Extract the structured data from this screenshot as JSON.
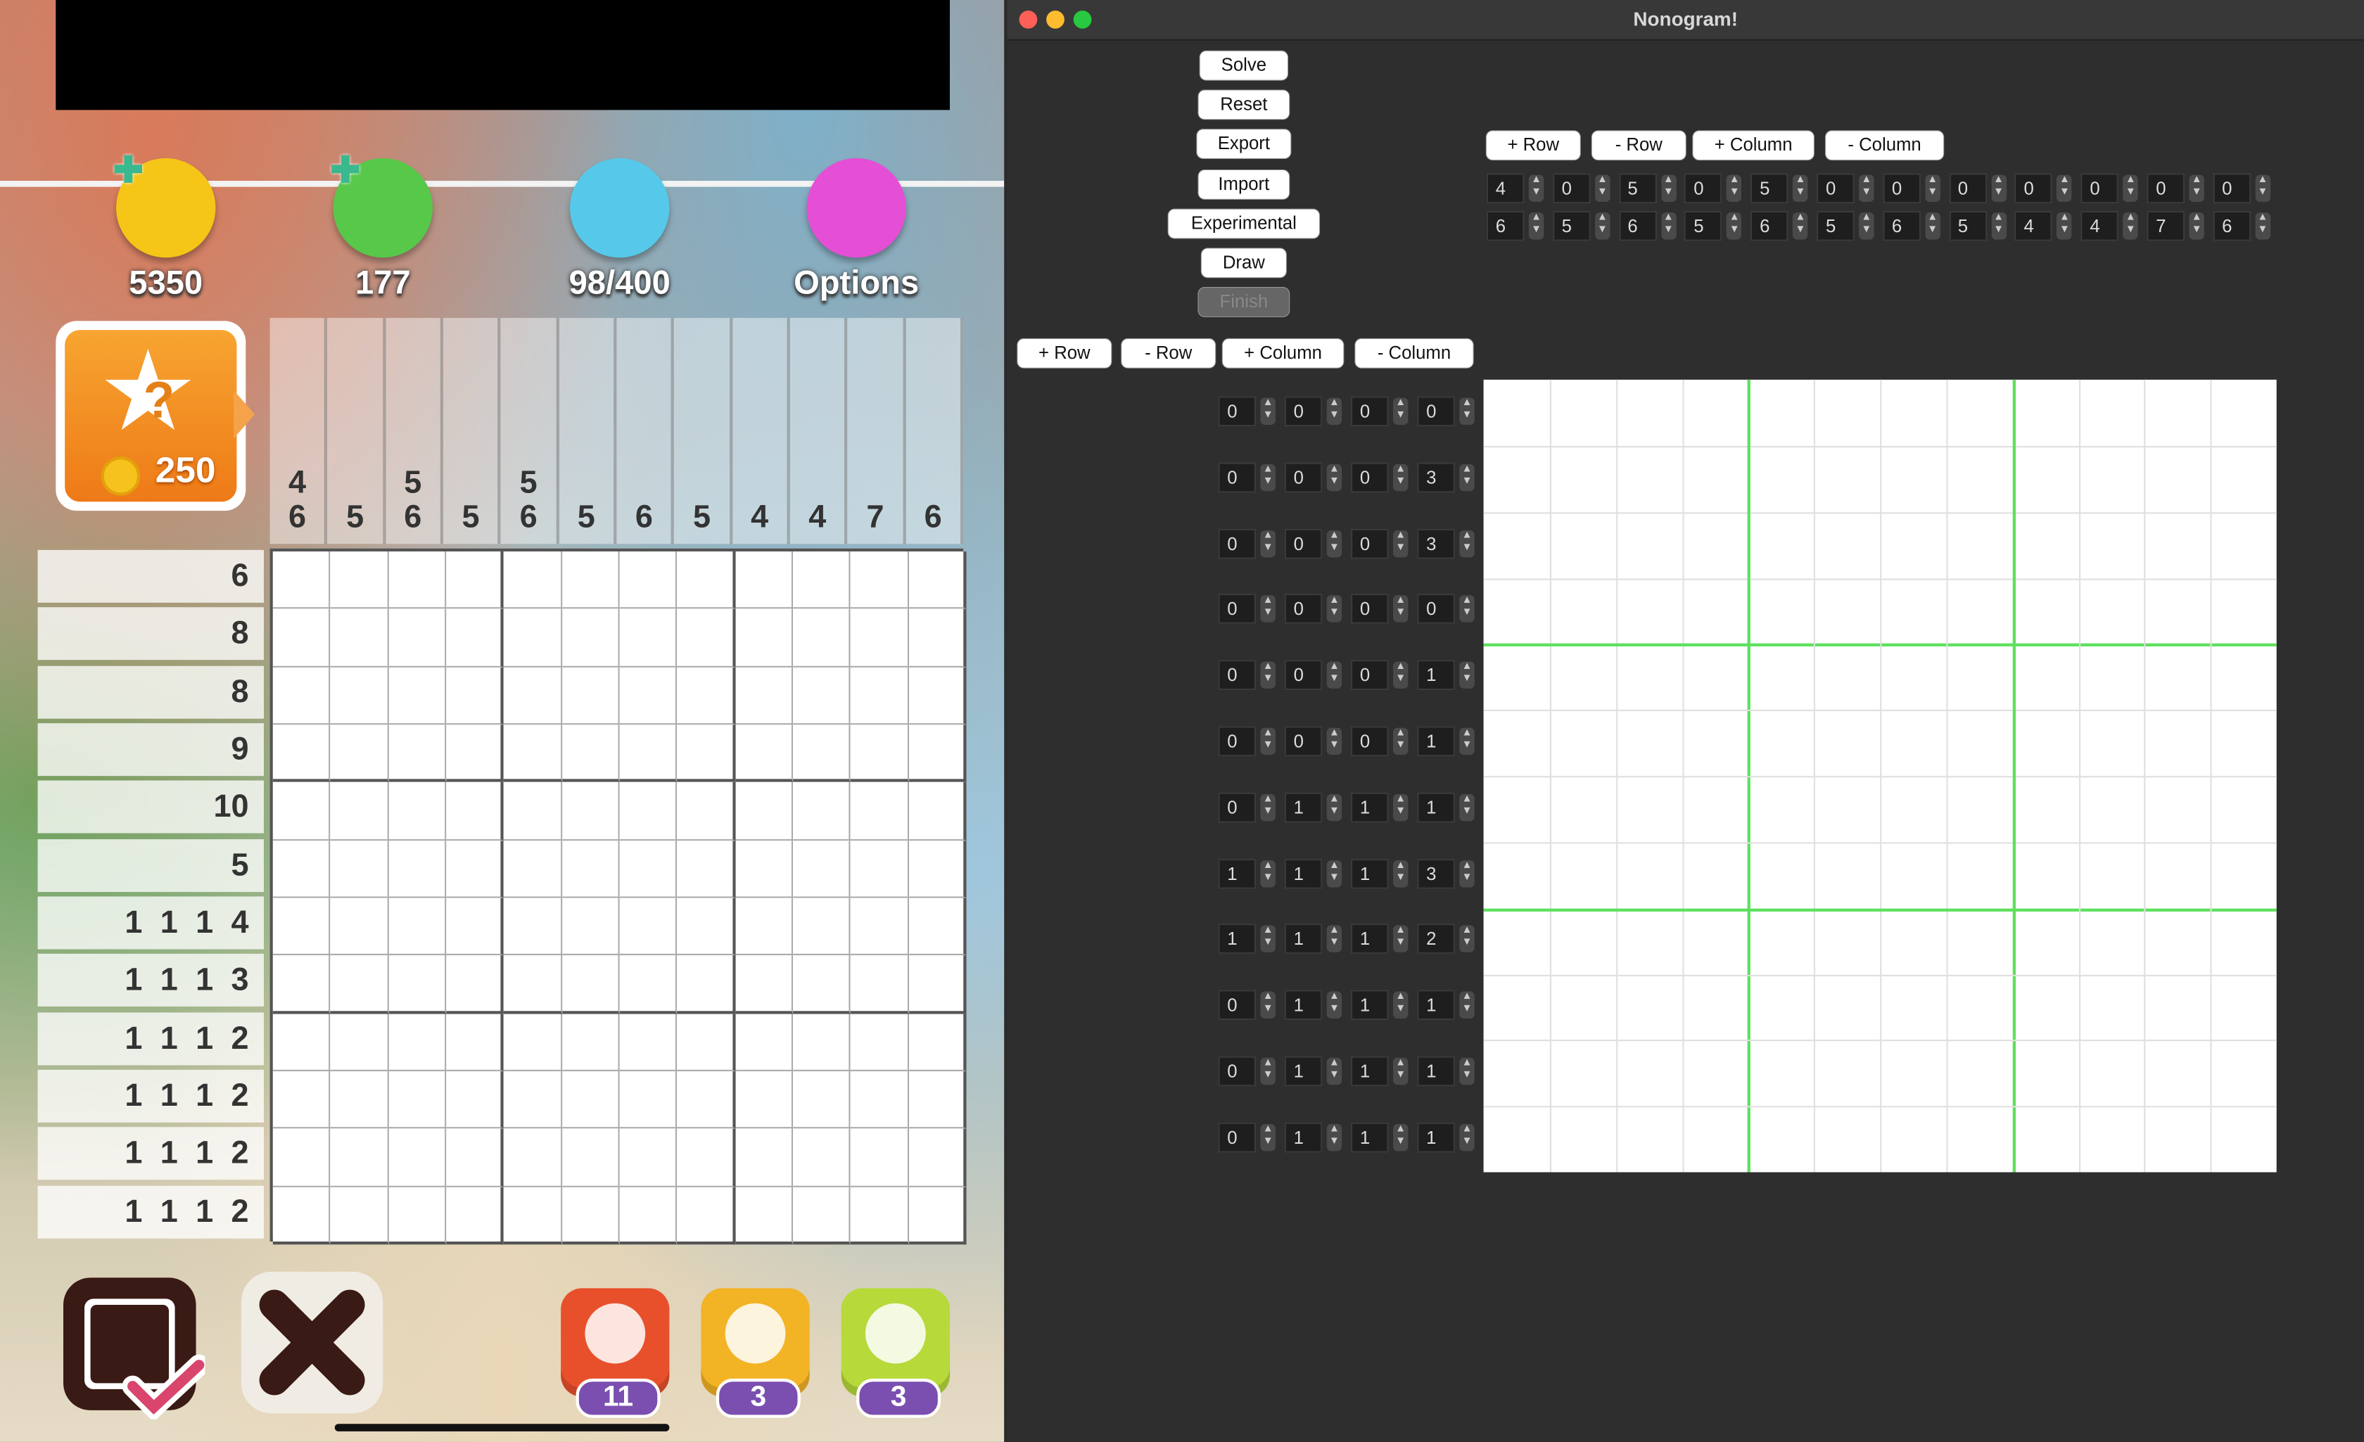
{
  "game": {
    "hud": [
      {
        "label": "5350",
        "icon": "gold-coin-icon",
        "color": "#f5c518"
      },
      {
        "label": "177",
        "icon": "green-question-coin-icon",
        "color": "#58c84a"
      },
      {
        "label": "98/400",
        "icon": "progress-chart-icon",
        "color": "#56c9ea"
      },
      {
        "label": "Options",
        "icon": "gear-icon",
        "color": "#e44fd6"
      }
    ],
    "hint": {
      "cost": "250",
      "icon": "question-star-icon"
    },
    "column_clues": [
      [
        "4",
        "6"
      ],
      [
        "5"
      ],
      [
        "5",
        "6"
      ],
      [
        "5"
      ],
      [
        "5",
        "6"
      ],
      [
        "5"
      ],
      [
        "6"
      ],
      [
        "5"
      ],
      [
        "4"
      ],
      [
        "4"
      ],
      [
        "7"
      ],
      [
        "6"
      ]
    ],
    "row_clues": [
      "6",
      "8",
      "8",
      "9",
      "10",
      "5",
      "1 1 1 4",
      "1 1 1 3",
      "1 1 1 2",
      "1 1 1 2",
      "1 1 1 2",
      "1 1 1 2"
    ],
    "boosters": [
      {
        "name": "bomb",
        "count": "11",
        "color": "#e8502c"
      },
      {
        "name": "stars",
        "count": "3",
        "color": "#f2b325"
      },
      {
        "name": "graduation",
        "count": "3",
        "color": "#b7d93a"
      }
    ]
  },
  "app": {
    "title": "Nonogram!",
    "actions": [
      "Solve",
      "Reset",
      "Export",
      "Import",
      "Experimental",
      "Draw",
      "Finish"
    ],
    "col_controls": [
      "+ Row",
      "- Row",
      "+ Column",
      "- Column"
    ],
    "row_controls": [
      "+ Row",
      "- Row",
      "+ Column",
      "- Column"
    ],
    "column_spinners": [
      [
        "4",
        "0",
        "5",
        "0",
        "5",
        "0",
        "0",
        "0",
        "0",
        "0",
        "0",
        "0"
      ],
      [
        "6",
        "5",
        "6",
        "5",
        "6",
        "5",
        "6",
        "5",
        "4",
        "4",
        "7",
        "6"
      ]
    ],
    "row_spinners": [
      [
        "0",
        "0",
        "0",
        "0"
      ],
      [
        "0",
        "0",
        "0",
        "3"
      ],
      [
        "0",
        "0",
        "0",
        "3"
      ],
      [
        "0",
        "0",
        "0",
        "0"
      ],
      [
        "0",
        "0",
        "0",
        "1"
      ],
      [
        "0",
        "0",
        "0",
        "1"
      ],
      [
        "0",
        "1",
        "1",
        "1"
      ],
      [
        "1",
        "1",
        "1",
        "3"
      ],
      [
        "1",
        "1",
        "1",
        "2"
      ],
      [
        "0",
        "1",
        "1",
        "1"
      ],
      [
        "0",
        "1",
        "1",
        "1"
      ],
      [
        "0",
        "1",
        "1",
        "1"
      ]
    ]
  }
}
